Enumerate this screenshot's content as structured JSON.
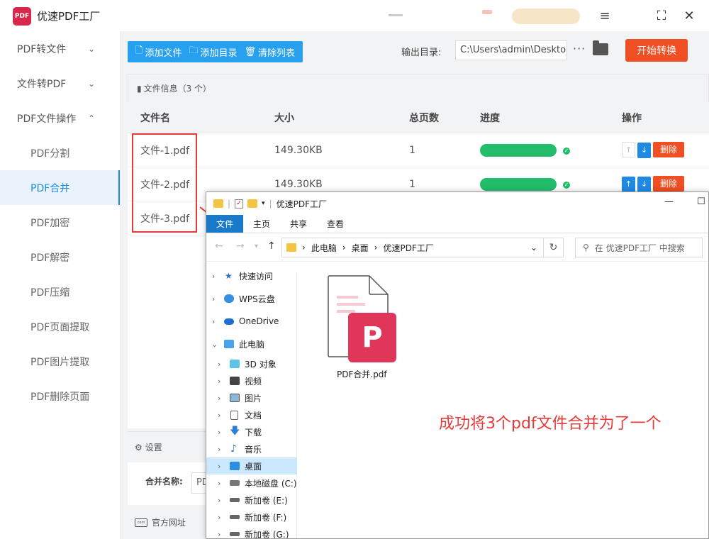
{
  "app": {
    "title": "优速PDF工厂",
    "logo_text": "PDF"
  },
  "sidebar": {
    "items": [
      {
        "label": "PDF转文件",
        "chev": "⌄"
      },
      {
        "label": "文件转PDF",
        "chev": "⌄"
      },
      {
        "label": "PDF文件操作",
        "chev": "⌃"
      },
      {
        "label": "PDF分割"
      },
      {
        "label": "PDF合并"
      },
      {
        "label": "PDF加密"
      },
      {
        "label": "PDF解密"
      },
      {
        "label": "PDF压缩"
      },
      {
        "label": "PDF页面提取"
      },
      {
        "label": "PDF图片提取"
      },
      {
        "label": "PDF删除页面"
      }
    ]
  },
  "toolbar": {
    "add_file": "添加文件",
    "add_dir": "添加目录",
    "clear_list": "清除列表",
    "output_label": "输出目录:",
    "output_path": "C:\\Users\\admin\\Deskto",
    "more": "···",
    "start": "开始转换"
  },
  "file_panel": {
    "header": "文件信息（3 个）",
    "columns": [
      "文件名",
      "大小",
      "总页数",
      "进度",
      "操作"
    ],
    "rows": [
      {
        "name": "文件-1.pdf",
        "size": "149.30KB",
        "pages": "1",
        "progress": 1.0
      },
      {
        "name": "文件-2.pdf",
        "size": "149.30KB",
        "pages": "1",
        "progress": 1.0
      },
      {
        "name": "文件-3.pdf"
      }
    ],
    "delete_label": "删除"
  },
  "settings": {
    "header": "设置",
    "merge_label": "合并名称:",
    "merge_value": "PD"
  },
  "footer": {
    "official_site": "官方网址",
    "com_icon_text": "com"
  },
  "explorer": {
    "title": "优速PDF工厂",
    "tabs": [
      "文件",
      "主页",
      "共享",
      "查看"
    ],
    "breadcrumb": [
      "此电脑",
      "桌面",
      "优速PDF工厂"
    ],
    "search_placeholder": "在 优速PDF工厂 中搜索",
    "tree": [
      {
        "label": "快速访问",
        "icon": "star-icon"
      },
      {
        "label": "WPS云盘",
        "icon": "cloud-icon"
      },
      {
        "label": "OneDrive",
        "icon": "onedrive-icon"
      },
      {
        "label": "此电脑",
        "icon": "computer-icon"
      },
      {
        "label": "3D 对象",
        "icon": "cube-icon"
      },
      {
        "label": "视频",
        "icon": "video-icon"
      },
      {
        "label": "图片",
        "icon": "picture-icon"
      },
      {
        "label": "文档",
        "icon": "document-icon"
      },
      {
        "label": "下载",
        "icon": "download-icon"
      },
      {
        "label": "音乐",
        "icon": "music-icon"
      },
      {
        "label": "桌面",
        "icon": "desktop-icon"
      },
      {
        "label": "本地磁盘 (C:)",
        "icon": "drive-icon"
      },
      {
        "label": "新加卷 (E:)",
        "icon": "drive-icon"
      },
      {
        "label": "新加卷 (F:)",
        "icon": "drive-icon"
      },
      {
        "label": "新加卷 (G:)",
        "icon": "drive-icon"
      }
    ],
    "file_name": "PDF合并.pdf",
    "file_badge": "P"
  },
  "annotation": {
    "success_text": "成功将3个pdf文件合并为了一个"
  },
  "colors": {
    "accent": "#1f8ae6",
    "danger": "#f04e23",
    "success": "#21bd6a",
    "annotation": "#e53b3b",
    "pdf_brand": "#e0365a"
  }
}
